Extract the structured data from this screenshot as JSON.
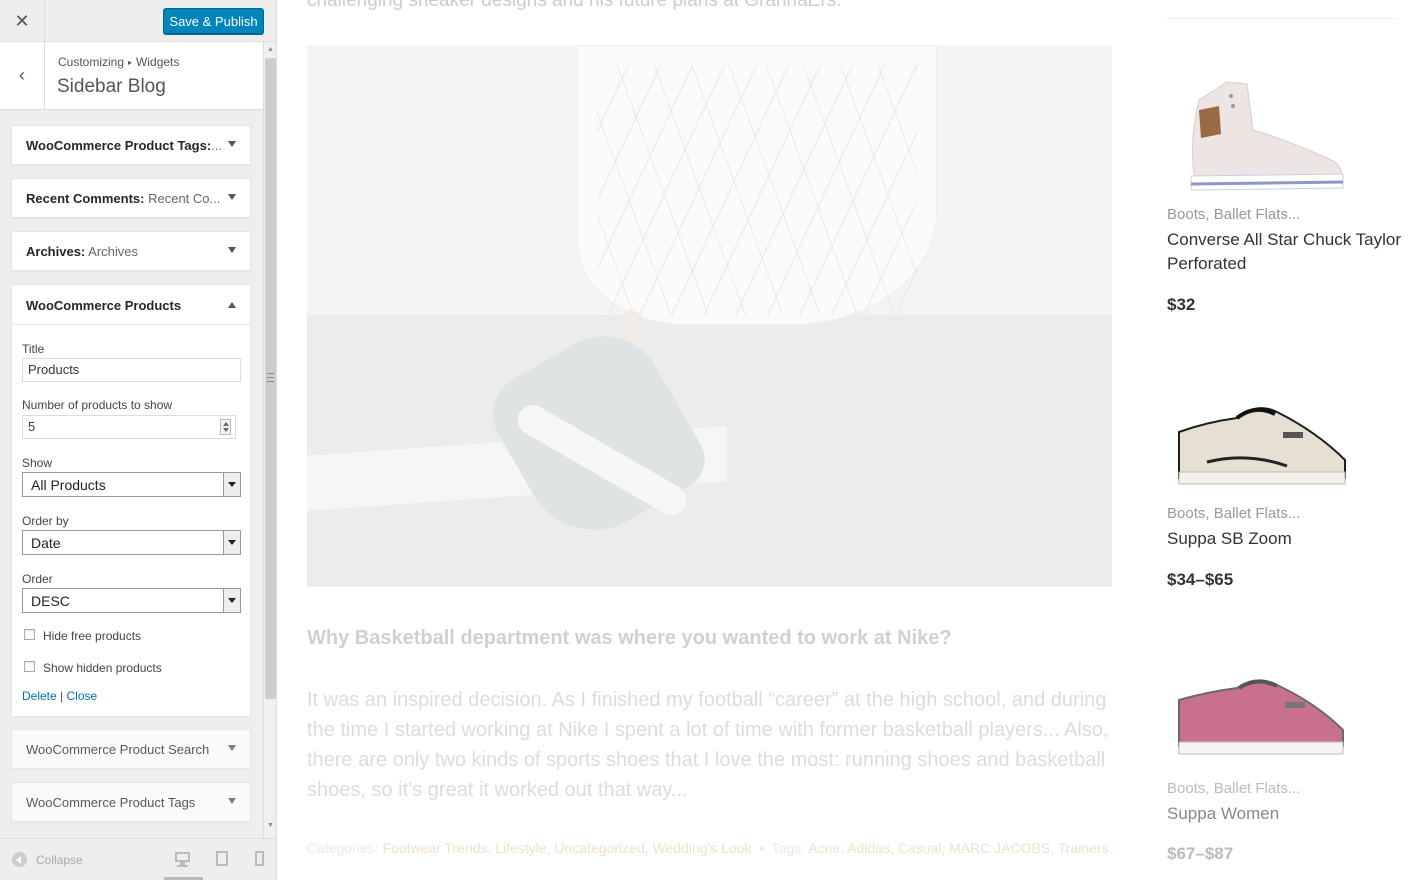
{
  "customizer": {
    "close_icon": "close-icon",
    "save_label": "Save & Publish",
    "breadcrumb": {
      "root": "Customizing",
      "current": "Widgets"
    },
    "section_title": "Sidebar Blog",
    "widgets": [
      {
        "title": "WooCommerce Product Tags:",
        "subtitle": "...",
        "expanded": false
      },
      {
        "title": "Recent Comments:",
        "subtitle": "Recent Co...",
        "expanded": false
      },
      {
        "title": "Archives:",
        "subtitle": "Archives",
        "expanded": false
      },
      {
        "title": "WooCommerce Products",
        "subtitle": "",
        "expanded": true
      },
      {
        "title": "WooCommerce Product Search",
        "subtitle": "",
        "expanded": false
      },
      {
        "title": "WooCommerce Product Tags",
        "subtitle": "",
        "expanded": false
      }
    ],
    "products_form": {
      "title_label": "Title",
      "title_value": "Products",
      "number_label": "Number of products to show",
      "number_value": "5",
      "show_label": "Show",
      "show_value": "All Products",
      "orderby_label": "Order by",
      "orderby_value": "Date",
      "order_label": "Order",
      "order_value": "DESC",
      "hide_free_label": "Hide free products",
      "hide_free_checked": false,
      "show_hidden_label": "Show hidden products",
      "show_hidden_checked": false,
      "delete_label": "Delete",
      "separator": "|",
      "close_label": "Close"
    },
    "footer": {
      "collapse_label": "Collapse",
      "active_device": "desktop"
    },
    "colors": {
      "primary_button": "#0085ba",
      "link": "#0073aa"
    }
  },
  "preview": {
    "top_text": "challenging sneaker designs and his future plans at GrannaErs.",
    "post_heading": "Why Basketball department was where you wanted to work at Nike?",
    "post_excerpt": "It was an inspired decision. As I finished my football “career” at the high school, and during the time I started working at Nike I spent a lot of time with former basketball players... Also, there are only two kinds of sports shoes that I love the most: running shoes and basketball shoes, so it’s great it worked out that way...",
    "post_meta": {
      "categories_label": "Categories:",
      "categories": "Footwear Trends, Lifestyle, Uncategorized, Wedding's Look",
      "tags_label": "Tags:",
      "tags": "Acne, Adidas, Casual, MARC JACOBS, Trainers"
    },
    "products": [
      {
        "category": "Boots, Ballet Flats...",
        "name": "Converse All Star Chuck Taylor Perforated",
        "price": "$32",
        "image": "white-high-top-sneaker"
      },
      {
        "category": "Boots, Ballet Flats...",
        "name": "Suppa SB Zoom",
        "price": "$34–$65",
        "image": "beige-low-top-sneaker"
      },
      {
        "category": "Boots, Ballet Flats...",
        "name": "Suppa Women",
        "price": "$67–$87",
        "image": "pink-low-top-sneaker"
      }
    ]
  }
}
